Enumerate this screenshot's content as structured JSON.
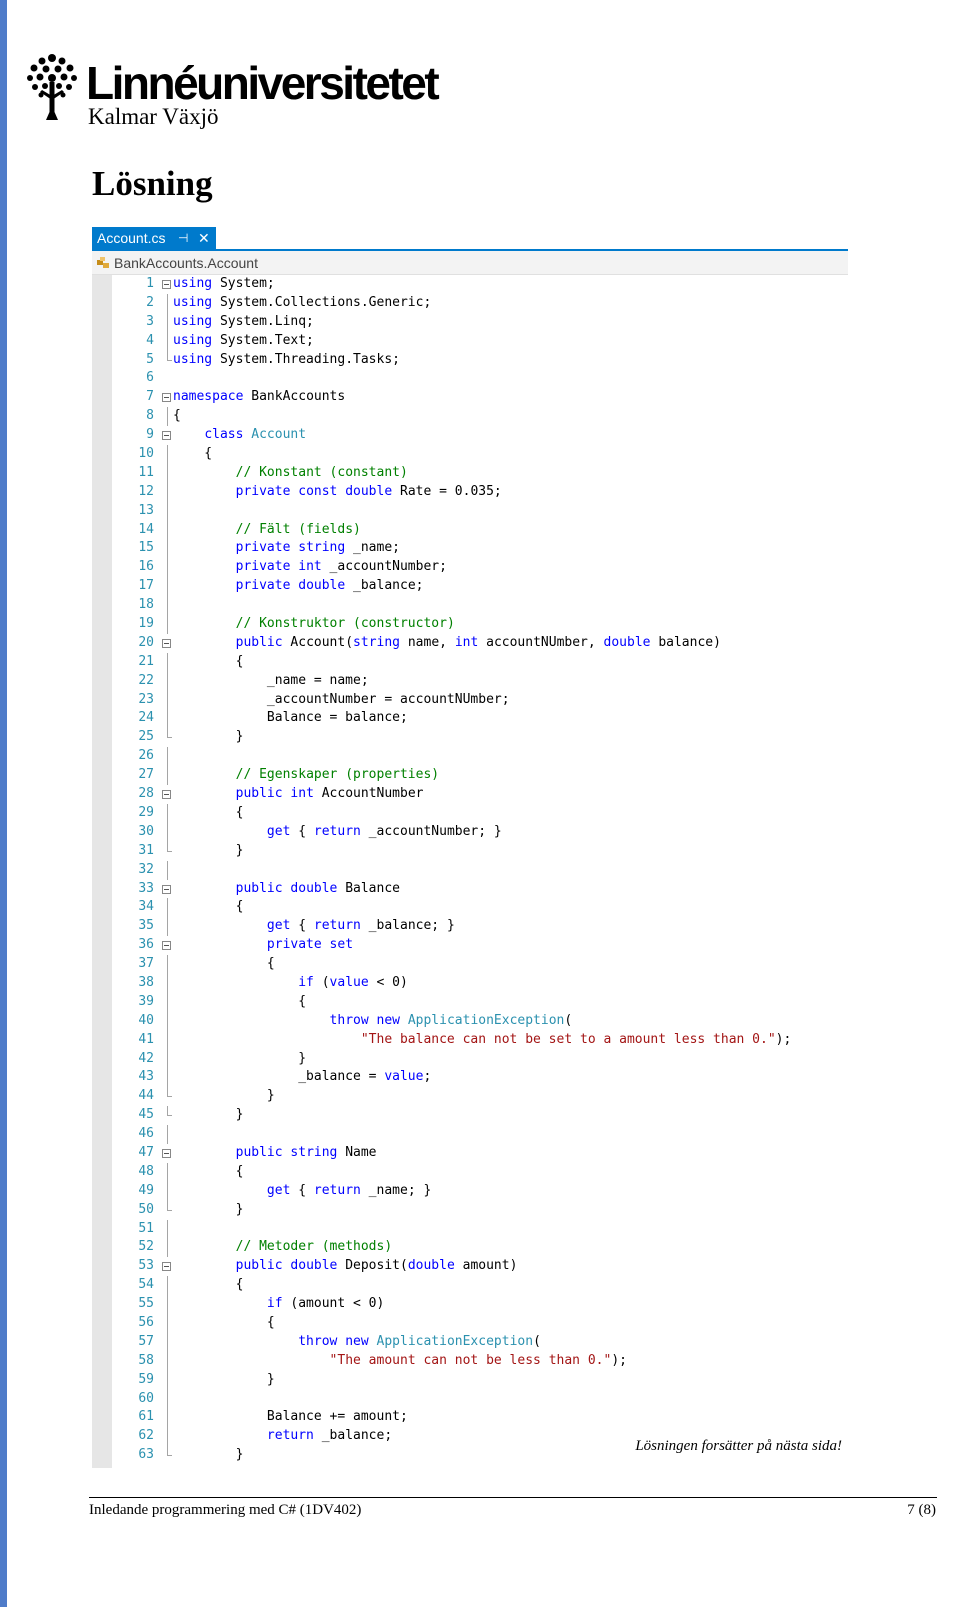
{
  "logo": {
    "name": "Linnéuniversitetet",
    "sub": "Kalmar Växjö"
  },
  "heading": "Lösning",
  "editor": {
    "tab": {
      "label": "Account.cs",
      "pin": "⊣",
      "close": "✕"
    },
    "nav": {
      "label": "BankAccounts.Account"
    },
    "colors": {
      "keyword": "#0000ff",
      "type": "#2b91af",
      "comment": "#008000",
      "string": "#a31515",
      "plain": "#000000",
      "line_number": "#2b91af",
      "tab": "#007acc"
    },
    "lines": [
      {
        "n": "1",
        "fold": true,
        "tokens": [
          [
            "k",
            "using"
          ],
          [
            "p",
            " System;"
          ]
        ]
      },
      {
        "n": "2",
        "guide": true,
        "tokens": [
          [
            "k",
            "using"
          ],
          [
            "p",
            " System.Collections.Generic;"
          ]
        ]
      },
      {
        "n": "3",
        "guide": true,
        "tokens": [
          [
            "k",
            "using"
          ],
          [
            "p",
            " System.Linq;"
          ]
        ]
      },
      {
        "n": "4",
        "guide": true,
        "tokens": [
          [
            "k",
            "using"
          ],
          [
            "p",
            " System.Text;"
          ]
        ]
      },
      {
        "n": "5",
        "guide": "end",
        "tokens": [
          [
            "k",
            "using"
          ],
          [
            "p",
            " System.Threading.Tasks;"
          ]
        ]
      },
      {
        "n": "6",
        "tokens": []
      },
      {
        "n": "7",
        "fold": true,
        "tokens": [
          [
            "k",
            "namespace"
          ],
          [
            "p",
            " BankAccounts"
          ]
        ]
      },
      {
        "n": "8",
        "guide": true,
        "tokens": [
          [
            "p",
            "{"
          ]
        ]
      },
      {
        "n": "9",
        "fold": true,
        "tokens": [
          [
            "p",
            "    "
          ],
          [
            "k",
            "class"
          ],
          [
            "p",
            " "
          ],
          [
            "t",
            "Account"
          ]
        ]
      },
      {
        "n": "10",
        "guide": true,
        "tokens": [
          [
            "p",
            "    {"
          ]
        ]
      },
      {
        "n": "11",
        "guide": true,
        "tokens": [
          [
            "p",
            "        "
          ],
          [
            "c",
            "// Konstant (constant)"
          ]
        ]
      },
      {
        "n": "12",
        "guide": true,
        "tokens": [
          [
            "p",
            "        "
          ],
          [
            "k",
            "private const double"
          ],
          [
            "p",
            " Rate = 0.035;"
          ]
        ]
      },
      {
        "n": "13",
        "guide": true,
        "tokens": []
      },
      {
        "n": "14",
        "guide": true,
        "tokens": [
          [
            "p",
            "        "
          ],
          [
            "c",
            "// Fält (fields)"
          ]
        ]
      },
      {
        "n": "15",
        "guide": true,
        "tokens": [
          [
            "p",
            "        "
          ],
          [
            "k",
            "private string"
          ],
          [
            "p",
            " _name;"
          ]
        ]
      },
      {
        "n": "16",
        "guide": true,
        "tokens": [
          [
            "p",
            "        "
          ],
          [
            "k",
            "private int"
          ],
          [
            "p",
            " _accountNumber;"
          ]
        ]
      },
      {
        "n": "17",
        "guide": true,
        "tokens": [
          [
            "p",
            "        "
          ],
          [
            "k",
            "private double"
          ],
          [
            "p",
            " _balance;"
          ]
        ]
      },
      {
        "n": "18",
        "guide": true,
        "tokens": []
      },
      {
        "n": "19",
        "guide": true,
        "tokens": [
          [
            "p",
            "        "
          ],
          [
            "c",
            "// Konstruktor (constructor)"
          ]
        ]
      },
      {
        "n": "20",
        "fold": true,
        "tokens": [
          [
            "p",
            "        "
          ],
          [
            "k",
            "public"
          ],
          [
            "p",
            " Account("
          ],
          [
            "k",
            "string"
          ],
          [
            "p",
            " name, "
          ],
          [
            "k",
            "int"
          ],
          [
            "p",
            " accountNUmber, "
          ],
          [
            "k",
            "double"
          ],
          [
            "p",
            " balance)"
          ]
        ]
      },
      {
        "n": "21",
        "guide": true,
        "tokens": [
          [
            "p",
            "        {"
          ]
        ]
      },
      {
        "n": "22",
        "guide": true,
        "tokens": [
          [
            "p",
            "            _name = name;"
          ]
        ]
      },
      {
        "n": "23",
        "guide": true,
        "tokens": [
          [
            "p",
            "            _accountNumber = accountNUmber;"
          ]
        ]
      },
      {
        "n": "24",
        "guide": true,
        "tokens": [
          [
            "p",
            "            Balance = balance;"
          ]
        ]
      },
      {
        "n": "25",
        "guide": "end",
        "tokens": [
          [
            "p",
            "        }"
          ]
        ]
      },
      {
        "n": "26",
        "guide": true,
        "tokens": []
      },
      {
        "n": "27",
        "guide": true,
        "tokens": [
          [
            "p",
            "        "
          ],
          [
            "c",
            "// Egenskaper (properties)"
          ]
        ]
      },
      {
        "n": "28",
        "fold": true,
        "tokens": [
          [
            "p",
            "        "
          ],
          [
            "k",
            "public int"
          ],
          [
            "p",
            " AccountNumber"
          ]
        ]
      },
      {
        "n": "29",
        "guide": true,
        "tokens": [
          [
            "p",
            "        {"
          ]
        ]
      },
      {
        "n": "30",
        "guide": true,
        "tokens": [
          [
            "p",
            "            "
          ],
          [
            "k",
            "get"
          ],
          [
            "p",
            " { "
          ],
          [
            "k",
            "return"
          ],
          [
            "p",
            " _accountNumber; }"
          ]
        ]
      },
      {
        "n": "31",
        "guide": "end",
        "tokens": [
          [
            "p",
            "        }"
          ]
        ]
      },
      {
        "n": "32",
        "guide": true,
        "tokens": []
      },
      {
        "n": "33",
        "fold": true,
        "tokens": [
          [
            "p",
            "        "
          ],
          [
            "k",
            "public double"
          ],
          [
            "p",
            " Balance"
          ]
        ]
      },
      {
        "n": "34",
        "guide": true,
        "tokens": [
          [
            "p",
            "        {"
          ]
        ]
      },
      {
        "n": "35",
        "guide": true,
        "tokens": [
          [
            "p",
            "            "
          ],
          [
            "k",
            "get"
          ],
          [
            "p",
            " { "
          ],
          [
            "k",
            "return"
          ],
          [
            "p",
            " _balance; }"
          ]
        ]
      },
      {
        "n": "36",
        "fold": true,
        "tokens": [
          [
            "p",
            "            "
          ],
          [
            "k",
            "private set"
          ]
        ]
      },
      {
        "n": "37",
        "guide": true,
        "tokens": [
          [
            "p",
            "            {"
          ]
        ]
      },
      {
        "n": "38",
        "guide": true,
        "tokens": [
          [
            "p",
            "                "
          ],
          [
            "k",
            "if"
          ],
          [
            "p",
            " ("
          ],
          [
            "k",
            "value"
          ],
          [
            "p",
            " < 0)"
          ]
        ]
      },
      {
        "n": "39",
        "guide": true,
        "tokens": [
          [
            "p",
            "                {"
          ]
        ]
      },
      {
        "n": "40",
        "guide": true,
        "tokens": [
          [
            "p",
            "                    "
          ],
          [
            "k",
            "throw new"
          ],
          [
            "p",
            " "
          ],
          [
            "t",
            "ApplicationException"
          ],
          [
            "p",
            "("
          ]
        ]
      },
      {
        "n": "41",
        "guide": true,
        "tokens": [
          [
            "p",
            "                        "
          ],
          [
            "s",
            "\"The balance can not be set to a amount less than 0.\""
          ],
          [
            "p",
            ");"
          ]
        ]
      },
      {
        "n": "42",
        "guide": true,
        "tokens": [
          [
            "p",
            "                }"
          ]
        ]
      },
      {
        "n": "43",
        "guide": true,
        "tokens": [
          [
            "p",
            "                _balance = "
          ],
          [
            "k",
            "value"
          ],
          [
            "p",
            ";"
          ]
        ]
      },
      {
        "n": "44",
        "guide": "end",
        "tokens": [
          [
            "p",
            "            }"
          ]
        ]
      },
      {
        "n": "45",
        "guide": "end",
        "tokens": [
          [
            "p",
            "        }"
          ]
        ]
      },
      {
        "n": "46",
        "guide": true,
        "tokens": []
      },
      {
        "n": "47",
        "fold": true,
        "tokens": [
          [
            "p",
            "        "
          ],
          [
            "k",
            "public string"
          ],
          [
            "p",
            " Name"
          ]
        ]
      },
      {
        "n": "48",
        "guide": true,
        "tokens": [
          [
            "p",
            "        {"
          ]
        ]
      },
      {
        "n": "49",
        "guide": true,
        "tokens": [
          [
            "p",
            "            "
          ],
          [
            "k",
            "get"
          ],
          [
            "p",
            " { "
          ],
          [
            "k",
            "return"
          ],
          [
            "p",
            " _name; }"
          ]
        ]
      },
      {
        "n": "50",
        "guide": "end",
        "tokens": [
          [
            "p",
            "        }"
          ]
        ]
      },
      {
        "n": "51",
        "guide": true,
        "tokens": []
      },
      {
        "n": "52",
        "guide": true,
        "tokens": [
          [
            "p",
            "        "
          ],
          [
            "c",
            "// Metoder (methods)"
          ]
        ]
      },
      {
        "n": "53",
        "fold": true,
        "tokens": [
          [
            "p",
            "        "
          ],
          [
            "k",
            "public double"
          ],
          [
            "p",
            " Deposit("
          ],
          [
            "k",
            "double"
          ],
          [
            "p",
            " amount)"
          ]
        ]
      },
      {
        "n": "54",
        "guide": true,
        "tokens": [
          [
            "p",
            "        {"
          ]
        ]
      },
      {
        "n": "55",
        "guide": true,
        "tokens": [
          [
            "p",
            "            "
          ],
          [
            "k",
            "if"
          ],
          [
            "p",
            " (amount < 0)"
          ]
        ]
      },
      {
        "n": "56",
        "guide": true,
        "tokens": [
          [
            "p",
            "            {"
          ]
        ]
      },
      {
        "n": "57",
        "guide": true,
        "tokens": [
          [
            "p",
            "                "
          ],
          [
            "k",
            "throw new"
          ],
          [
            "p",
            " "
          ],
          [
            "t",
            "ApplicationException"
          ],
          [
            "p",
            "("
          ]
        ]
      },
      {
        "n": "58",
        "guide": true,
        "tokens": [
          [
            "p",
            "                    "
          ],
          [
            "s",
            "\"The amount can not be less than 0.\""
          ],
          [
            "p",
            ");"
          ]
        ]
      },
      {
        "n": "59",
        "guide": true,
        "tokens": [
          [
            "p",
            "            }"
          ]
        ]
      },
      {
        "n": "60",
        "guide": true,
        "tokens": []
      },
      {
        "n": "61",
        "guide": true,
        "tokens": [
          [
            "p",
            "            Balance += amount;"
          ]
        ]
      },
      {
        "n": "62",
        "guide": true,
        "tokens": [
          [
            "p",
            "            "
          ],
          [
            "k",
            "return"
          ],
          [
            "p",
            " _balance;"
          ]
        ]
      },
      {
        "n": "63",
        "guide": "end",
        "tokens": [
          [
            "p",
            "        }"
          ]
        ]
      }
    ]
  },
  "footer": {
    "note": "Lösningen forsätter på nästa sida!",
    "course": "Inledande programmering med C# (1DV402)",
    "page": "7 (8)"
  }
}
